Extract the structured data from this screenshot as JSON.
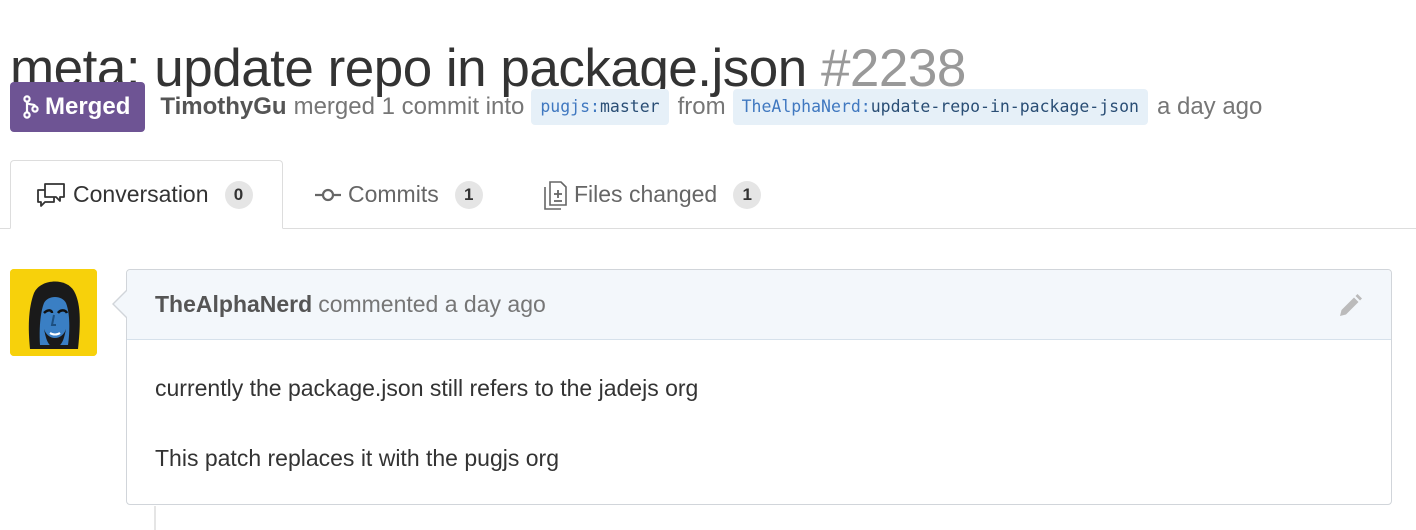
{
  "pr": {
    "title": "meta: update repo in package.json",
    "number": "#2238",
    "state": "Merged",
    "state_color": "#6e5494",
    "merger": "TimothyGu",
    "merged_text": "merged 1 commit into",
    "base_branch": {
      "user": "pugjs",
      "sep": ":",
      "ref": "master"
    },
    "from_text": "from",
    "head_branch": {
      "user": "TheAlphaNerd",
      "sep": ":",
      "ref": "update-repo-in-package-json"
    },
    "time": "a day ago"
  },
  "tabs": [
    {
      "label": "Conversation",
      "count": "0",
      "icon": "comment-discussion-icon",
      "selected": true
    },
    {
      "label": "Commits",
      "count": "1",
      "icon": "git-commit-icon",
      "selected": false
    },
    {
      "label": "Files changed",
      "count": "1",
      "icon": "diff-icon",
      "selected": false
    }
  ],
  "comment": {
    "author": "TheAlphaNerd",
    "action": "commented a day ago",
    "avatar_bg": "#f7d10b",
    "body": [
      "currently the package.json still refers to the jadejs org",
      "This patch replaces it with the pugjs org"
    ],
    "edit_icon": "pencil-icon"
  }
}
